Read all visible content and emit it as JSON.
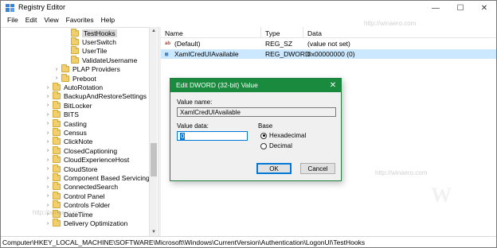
{
  "window": {
    "title": "Registry Editor",
    "minimize": "—",
    "maximize": "☐",
    "close": "✕"
  },
  "menu": [
    "File",
    "Edit",
    "View",
    "Favorites",
    "Help"
  ],
  "tree": {
    "items": [
      {
        "label": "TestHooks",
        "expander": "",
        "selected": true
      },
      {
        "label": "UserSwitch",
        "expander": ""
      },
      {
        "label": "UserTile",
        "expander": ""
      },
      {
        "label": "ValidateUsername",
        "expander": ""
      },
      {
        "label": "PLAP Providers",
        "expander": "›"
      },
      {
        "label": "Preboot",
        "expander": "›"
      },
      {
        "label": "AutoRotation",
        "expander": "›"
      },
      {
        "label": "BackupAndRestoreSettings",
        "expander": "›"
      },
      {
        "label": "BitLocker",
        "expander": "›"
      },
      {
        "label": "BITS",
        "expander": "›"
      },
      {
        "label": "Casting",
        "expander": "›"
      },
      {
        "label": "Census",
        "expander": "›"
      },
      {
        "label": "ClickNote",
        "expander": "›"
      },
      {
        "label": "ClosedCaptioning",
        "expander": "›"
      },
      {
        "label": "CloudExperienceHost",
        "expander": "›"
      },
      {
        "label": "CloudStore",
        "expander": "›"
      },
      {
        "label": "Component Based Servicing",
        "expander": "›"
      },
      {
        "label": "ConnectedSearch",
        "expander": "›"
      },
      {
        "label": "Control Panel",
        "expander": "›"
      },
      {
        "label": "Controls Folder",
        "expander": "›"
      },
      {
        "label": "DateTime",
        "expander": "›"
      },
      {
        "label": "Delivery Optimization",
        "expander": "›"
      }
    ]
  },
  "list": {
    "columns": [
      "Name",
      "Type",
      "Data"
    ],
    "rows": [
      {
        "icon": "ab",
        "name": "(Default)",
        "type": "REG_SZ",
        "data": "(value not set)"
      },
      {
        "icon": "bin",
        "name": "XamlCredUIAvailable",
        "type": "REG_DWORD",
        "data": "0x00000000 (0)",
        "selected": true
      }
    ]
  },
  "status": {
    "path": "Computer\\HKEY_LOCAL_MACHINE\\SOFTWARE\\Microsoft\\Windows\\CurrentVersion\\Authentication\\LogonUI\\TestHooks"
  },
  "dialog": {
    "title": "Edit DWORD (32-bit) Value",
    "close": "✕",
    "value_name_label": "Value name:",
    "value_name": "XamlCredUIAvailable",
    "value_data_label": "Value data:",
    "value_data": "0",
    "base_label": "Base",
    "radio_hex": "Hexadecimal",
    "radio_dec": "Decimal",
    "ok": "OK",
    "cancel": "Cancel"
  },
  "watermark": {
    "site": "http://winaero.com",
    "letter": "W"
  },
  "colors": {
    "dialog_title_bg": "#1a8a3f",
    "selection": "#cce8ff",
    "folder": "#f2cf6d"
  }
}
